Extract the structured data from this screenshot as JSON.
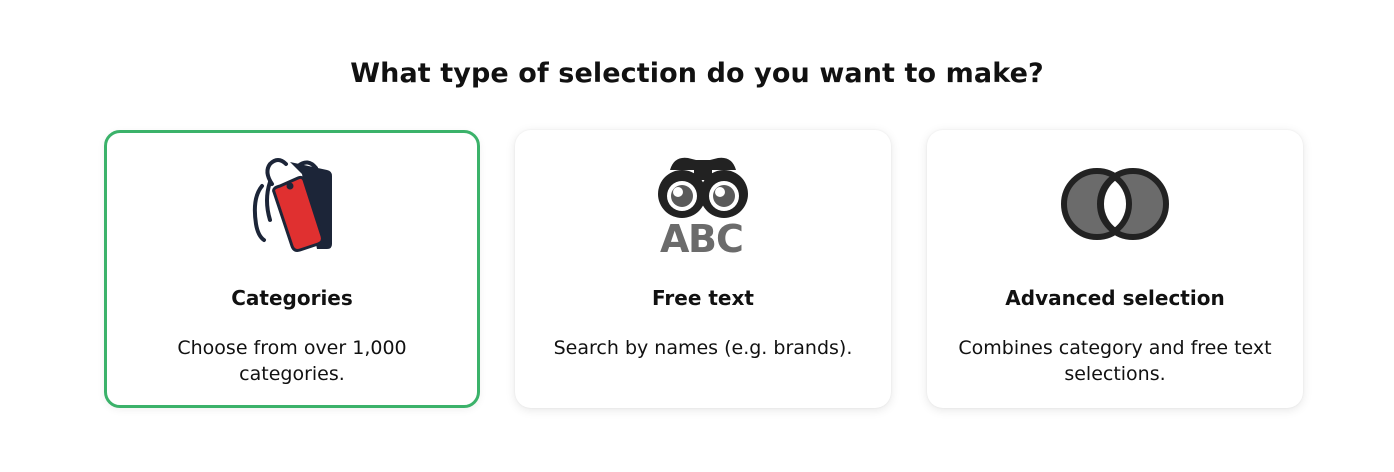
{
  "heading": "What type of selection do you want to make?",
  "options": [
    {
      "title": "Categories",
      "description": "Choose from over 1,000 categories.",
      "icon": "tag-icon",
      "selected": true
    },
    {
      "title": "Free text",
      "description": "Search by names (e.g. brands).",
      "icon": "binoculars-abc-icon",
      "selected": false
    },
    {
      "title": "Advanced selection",
      "description": "Combines category and free text selections.",
      "icon": "overlapping-circles-icon",
      "selected": false
    }
  ],
  "colors": {
    "selected_border": "#3bb26a",
    "tag_red": "#e03030",
    "tag_navy": "#1c2538",
    "icon_dark": "#222222",
    "icon_gray": "#6b6b6b"
  }
}
